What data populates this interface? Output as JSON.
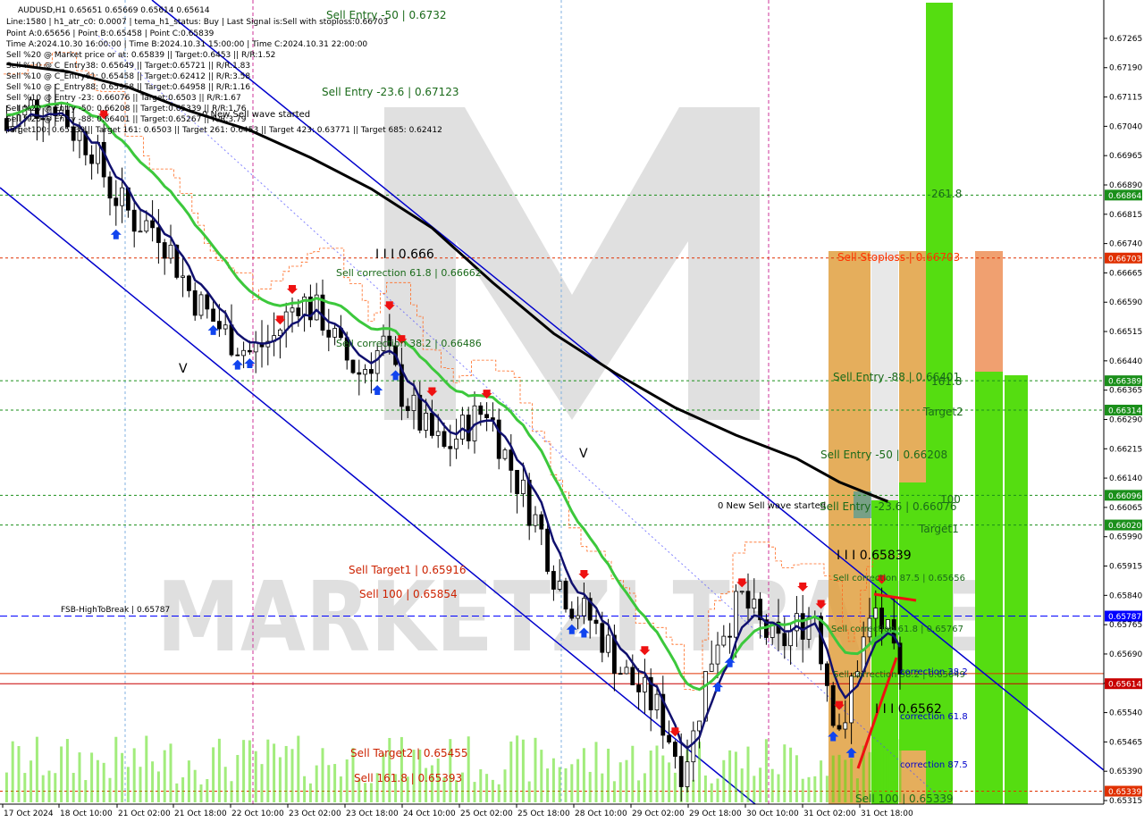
{
  "header": {
    "line1": "AUDUSD,H1  0.65651 0.65669 0.65614 0.65614",
    "line2": "Line:1580 | h1_atr_c0: 0.0007 | tema_h1_status: Buy | Last Signal is:Sell with stoploss:0.66703",
    "line3": "Point A:0.65656 | Point B:0.65458 | Point C:0.65839",
    "line4": "Time A:2024.10.30 16:00:00 | Time B:2024.10.31 15:00:00 | Time C:2024.10.31 22:00:00",
    "line5": "Sell %20 @ Market price or at: 0.65839 || Target:0.6453 || R/R:1.52",
    "line6": "Sell %10 @ C_Entry38: 0.65649 || Target:0.65721 || R/R:1.83",
    "line7": "Sell %10 @ C_Entry61: 0.65458 || Target:0.62412 || R/R:3.58",
    "line8": "Sell %10 @ C_Entry88: 0.65958 || Target:0.64958 || R/R:1.16",
    "line9": "Sell %10 @ Entry -23: 0.66076 || Target:0.6503 || R/R:1.67",
    "line10": "Sell %20 @ Entry -50: 0.66208 || Target:0.65339 || R/R:1.76",
    "line11": "Sell %20 @ Entry -88: 0.66401 || Target:0.65267 || R/R:3.79",
    "line12": "Target100: 0.65339 || Target 161: 0.6503 || Target 261: 0.6453 || Target 423: 0.63771 || Target 685: 0.62412"
  },
  "annotations": {
    "sell_entry_50_top": "Sell Entry -50 | 0.6732",
    "sell_entry_23_top": "Sell Entry -23.6 | 0.67123",
    "new_sell_wave_1": "0 New Sell wave started",
    "iii_0666": "I I I 0.666",
    "sell_correction_61": "Sell correction 61.8 | 0.66662",
    "sell_correction_38": "Sell correction 38.2 | 0.66486",
    "v_mark_1": "V",
    "v_mark_2": "V",
    "sell_target1": "Sell Target1 | 0.65916",
    "sell_100": "Sell 100 | 0.65854",
    "fsb": "FSB-HighToBreak | 0.65787",
    "sell_target2": "Sell Target2 | 0.65455",
    "sell_161": "Sell 161.8 | 0.65393",
    "new_sell_wave_2": "0 New Sell wave started",
    "sell_stoploss": "Sell Stoploss | 0.66703",
    "sell_entry_88": "Sell Entry -88 | 0.66401",
    "sell_entry_50": "Sell Entry -50 | 0.66208",
    "sell_entry_23": "Sell Entry -23.6 | 0.66076",
    "iii_65839": "I I I 0.65839",
    "sell_correction_87": "Sell correction 87.5 | 0.65656",
    "sell_correction_61b": "Sell correction 61.8 | 0.65767",
    "sell_correction_38b": "Sell correction 38.2 | 0.65649",
    "iii_6562": "I I I 0.6562",
    "sell_100_bottom": "Sell 100 | 0.65339",
    "lvl_261": "261.8",
    "lvl_161": "161.8",
    "lvl_target2": "Target2",
    "lvl_100": "100",
    "lvl_target1": "Target1",
    "corr_382": "correction 38.2",
    "corr_618": "correction 61.8",
    "corr_875": "correction 87.5",
    "watermark": "MARKETZI TRADE"
  },
  "colors": {
    "background": "#ffffff",
    "candle": "#000000",
    "ma_green": "#3cc83c",
    "ma_navy": "#10106e",
    "ma_black": "#000000",
    "channel": "#0000cc",
    "orange_box": "#e0a040",
    "green_box": "#55dd11",
    "salmon_box": "#f0a070",
    "level_green": "#1a8f1a",
    "level_red": "#e03000",
    "level_blue": "#0000ff",
    "current_price": "#c80000"
  },
  "chart_data": {
    "type": "candlestick",
    "symbol": "AUDUSD",
    "timeframe": "H1",
    "ylim": [
      0.65315,
      0.6729
    ],
    "y_ticks": [
      "0.67265",
      "0.67190",
      "0.67115",
      "0.67040",
      "0.66965",
      "0.66890",
      "0.66815",
      "0.66740",
      "0.66665",
      "0.66590",
      "0.66515",
      "0.66440",
      "0.66365",
      "0.66290",
      "0.66215",
      "0.66140",
      "0.66065",
      "0.65990",
      "0.65915",
      "0.65840",
      "0.65765",
      "0.65690",
      "0.65615",
      "0.65540",
      "0.65465",
      "0.65390",
      "0.65315"
    ],
    "x_ticks": [
      "17 Oct 2024",
      "18 Oct 10:00",
      "21 Oct 02:00",
      "21 Oct 18:00",
      "22 Oct 10:00",
      "23 Oct 02:00",
      "23 Oct 18:00",
      "24 Oct 10:00",
      "25 Oct 02:00",
      "25 Oct 18:00",
      "28 Oct 10:00",
      "29 Oct 02:00",
      "29 Oct 18:00",
      "30 Oct 10:00",
      "31 Oct 02:00",
      "31 Oct 18:00"
    ],
    "price_levels": [
      {
        "value": 0.66864,
        "label": "0.66864",
        "color": "#1a8f1a"
      },
      {
        "value": 0.66703,
        "label": "0.66703",
        "color": "#e03000"
      },
      {
        "value": 0.66389,
        "label": "0.66389",
        "color": "#1a8f1a"
      },
      {
        "value": 0.66314,
        "label": "0.66314",
        "color": "#1a8f1a"
      },
      {
        "value": 0.66096,
        "label": "0.66096",
        "color": "#1a8f1a"
      },
      {
        "value": 0.6602,
        "label": "0.66020",
        "color": "#1a8f1a"
      },
      {
        "value": 0.65787,
        "label": "0.65787",
        "color": "#0000ff"
      },
      {
        "value": 0.65614,
        "label": "0.65614",
        "color": "#c80000"
      },
      {
        "value": 0.65339,
        "label": "0.65339",
        "color": "#e03000"
      }
    ],
    "close_path": [
      [
        0,
        0.6703
      ],
      [
        4,
        0.6709
      ],
      [
        8,
        0.671
      ],
      [
        11,
        0.6703
      ],
      [
        14,
        0.6699
      ],
      [
        17,
        0.6688
      ],
      [
        21,
        0.668
      ],
      [
        25,
        0.6678
      ],
      [
        27,
        0.6672
      ],
      [
        30,
        0.6662
      ],
      [
        33,
        0.6656
      ],
      [
        36,
        0.6651
      ],
      [
        40,
        0.6646
      ],
      [
        44,
        0.665
      ],
      [
        48,
        0.666
      ],
      [
        52,
        0.6655
      ],
      [
        55,
        0.6646
      ],
      [
        58,
        0.6641
      ],
      [
        62,
        0.6648
      ],
      [
        65,
        0.6636
      ],
      [
        69,
        0.6626
      ],
      [
        72,
        0.6621
      ],
      [
        76,
        0.6628
      ],
      [
        79,
        0.6632
      ],
      [
        82,
        0.662
      ],
      [
        85,
        0.661
      ],
      [
        88,
        0.66
      ],
      [
        90,
        0.659
      ],
      [
        93,
        0.6582
      ],
      [
        96,
        0.6578
      ],
      [
        99,
        0.6571
      ],
      [
        101,
        0.6565
      ],
      [
        104,
        0.656
      ],
      [
        107,
        0.6555
      ],
      [
        109,
        0.6548
      ],
      [
        111,
        0.654
      ],
      [
        113,
        0.6548
      ],
      [
        115,
        0.6563
      ],
      [
        117,
        0.6574
      ],
      [
        119,
        0.6578
      ],
      [
        121,
        0.6583
      ],
      [
        124,
        0.6576
      ],
      [
        127,
        0.6571
      ],
      [
        130,
        0.6576
      ],
      [
        133,
        0.658
      ],
      [
        134,
        0.657
      ],
      [
        136,
        0.6555
      ],
      [
        138,
        0.6548
      ],
      [
        139,
        0.6562
      ],
      [
        141,
        0.6572
      ],
      [
        143,
        0.658
      ],
      [
        145,
        0.6573
      ],
      [
        147,
        0.6561
      ]
    ],
    "ma_slow_path": [
      [
        0,
        0.672
      ],
      [
        10,
        0.6718
      ],
      [
        20,
        0.6714
      ],
      [
        30,
        0.6708
      ],
      [
        40,
        0.6703
      ],
      [
        50,
        0.6696
      ],
      [
        60,
        0.6688
      ],
      [
        70,
        0.6678
      ],
      [
        80,
        0.6664
      ],
      [
        90,
        0.6651
      ],
      [
        100,
        0.6641
      ],
      [
        110,
        0.6632
      ],
      [
        120,
        0.6625
      ],
      [
        130,
        0.6619
      ],
      [
        137,
        0.6613
      ],
      [
        145,
        0.6608
      ]
    ]
  }
}
